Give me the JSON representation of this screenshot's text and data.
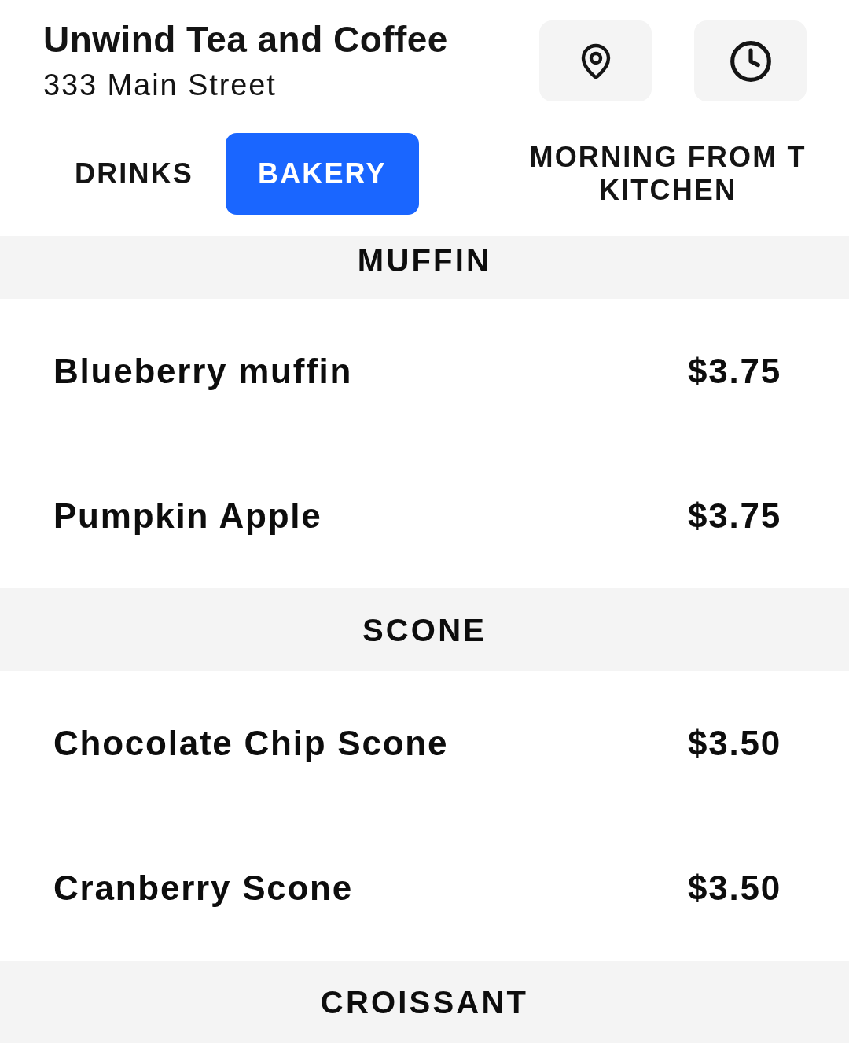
{
  "header": {
    "title": "Unwind Tea and Coffee",
    "address": "333 Main Street"
  },
  "tabs": [
    {
      "label": "DRINKS",
      "selected": false
    },
    {
      "label": "BAKERY",
      "selected": true
    },
    {
      "label": "MORNING FROM T KITCHEN",
      "selected": false
    }
  ],
  "sections": [
    {
      "title": "MUFFIN",
      "items": [
        {
          "name": "Blueberry muffin",
          "price": "$3.75"
        },
        {
          "name": "Pumpkin Apple",
          "price": "$3.75"
        }
      ]
    },
    {
      "title": "SCONE",
      "items": [
        {
          "name": "Chocolate Chip Scone",
          "price": "$3.50"
        },
        {
          "name": "Cranberry Scone",
          "price": "$3.50"
        }
      ]
    },
    {
      "title": "CROISSANT"
    }
  ]
}
